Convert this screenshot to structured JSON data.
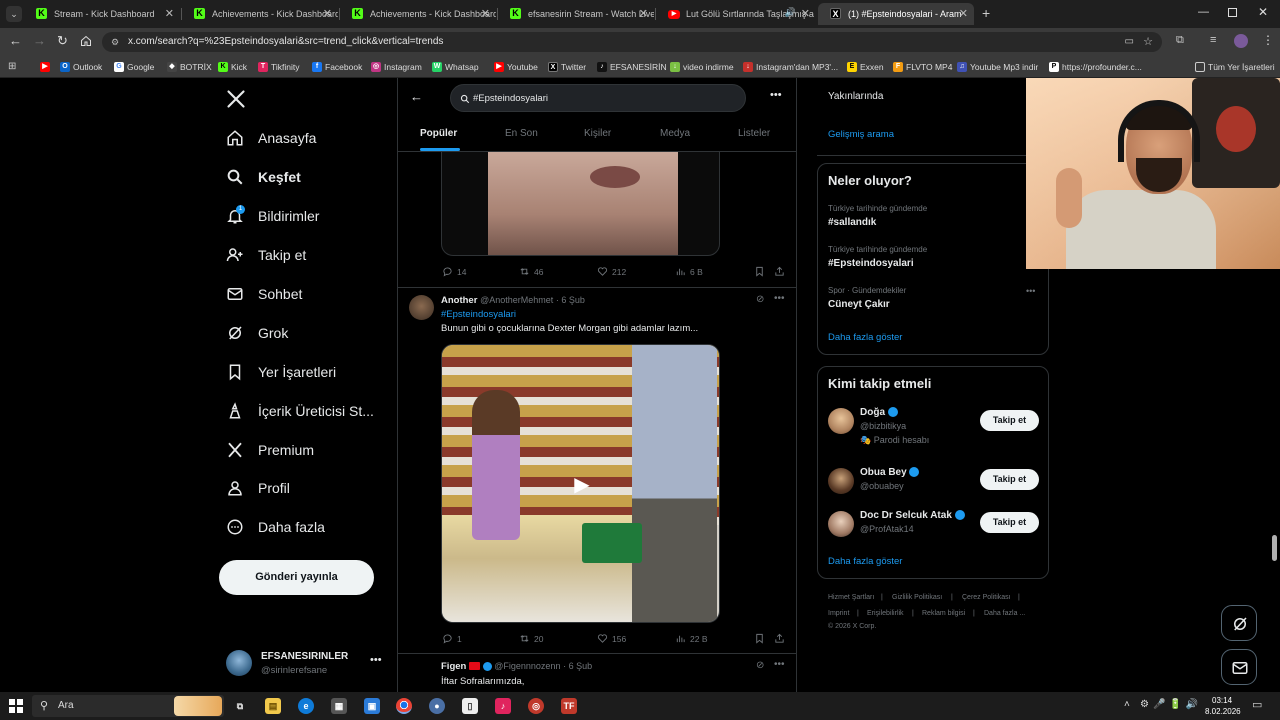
{
  "browser": {
    "tabs": [
      {
        "title": "Stream - Kick Dashboard",
        "icon": "kick-icon"
      },
      {
        "title": "Achievements - Kick Dashboard",
        "icon": "kick-icon"
      },
      {
        "title": "Achievements - Kick Dashboard",
        "icon": "kick-icon"
      },
      {
        "title": "efsanesirin Stream - Watch Live",
        "icon": "kick-icon"
      },
      {
        "title": "Lut Gölü Sırtlarında Taşlaşmış a",
        "icon": "youtube-icon"
      },
      {
        "title": "(1) #Epsteindosyalari - Aram",
        "icon": "x-icon"
      }
    ],
    "url": "x.com/search?q=%23Epsteindosyalari&src=trend_click&vertical=trends",
    "bookmarks": [
      "Outlook",
      "Google",
      "BOTRİX",
      "Kick",
      "Tikfinity",
      "Facebook",
      "Instagram",
      "Whatsap",
      "Youtube",
      "Twitter",
      "EFSANESİRİN",
      "video indirme",
      "Instagram'dan MP3'...",
      "Exxen",
      "FLVTO MP4",
      "Youtube Mp3 indir",
      "https://profounder.c..."
    ],
    "bookmarks_all": "Tüm Yer İşaretleri"
  },
  "nav": {
    "items": [
      {
        "label": "Anasayfa",
        "icon": "home-icon"
      },
      {
        "label": "Keşfet",
        "icon": "search-icon"
      },
      {
        "label": "Bildirimler",
        "icon": "bell-icon",
        "badge": "1"
      },
      {
        "label": "Takip et",
        "icon": "add-user-icon"
      },
      {
        "label": "Sohbet",
        "icon": "mail-icon"
      },
      {
        "label": "Grok",
        "icon": "grok-icon"
      },
      {
        "label": "Yer İşaretleri",
        "icon": "bookmark-icon"
      },
      {
        "label": "İçerik Üreticisi St...",
        "icon": "creator-icon"
      },
      {
        "label": "Premium",
        "icon": "x-icon"
      },
      {
        "label": "Profil",
        "icon": "person-icon"
      },
      {
        "label": "Daha fazla",
        "icon": "more-circle-icon"
      }
    ],
    "post_button": "Gönderi yayınla",
    "account": {
      "name": "EFSANESIRINLER",
      "handle": "@sirinlerefsane"
    }
  },
  "search": {
    "query": "#Epsteindosyalari",
    "tabs": [
      "Popüler",
      "En Son",
      "Kişiler",
      "Medya",
      "Listeler"
    ],
    "active_tab": "Popüler"
  },
  "tweets": [
    {
      "stats": {
        "replies": "14",
        "retweets": "46",
        "likes": "212",
        "views": "6 B"
      }
    },
    {
      "name": "Another",
      "handle": "@AnotherMehmet",
      "date": "· 6 Şub",
      "hashtag": "#Epsteindosyalari",
      "text": "Bunun gibi o çocuklarına Dexter Morgan gibi adamlar lazım...",
      "stats": {
        "replies": "1",
        "retweets": "20",
        "likes": "156",
        "views": "22 B"
      }
    },
    {
      "name": "Figen",
      "handle": "@Figennnozenn",
      "date": "· 6 Şub",
      "text": "İftar Sofralarımızda,"
    }
  ],
  "right": {
    "location_fragment": "Yakınlarında",
    "advanced_search": "Gelişmiş arama",
    "trends_title": "Neler oluyor?",
    "trends": [
      {
        "category": "Türkiye tarihinde gündemde",
        "name": "#sallandık"
      },
      {
        "category": "Türkiye tarihinde gündemde",
        "name": "#Epsteindosyalari"
      },
      {
        "category": "Spor · Gündemdekiler",
        "name": "Cüneyt Çakır"
      }
    ],
    "trends_more": "Daha fazla göster",
    "who_title": "Kimi takip etmeli",
    "who": [
      {
        "name": "Doğa",
        "handle": "@bizbitikya",
        "extra": "Parodi hesabı",
        "button": "Takip et"
      },
      {
        "name": "Obua Bey",
        "handle": "@obuabey",
        "button": "Takip et"
      },
      {
        "name": "Doc Dr Selcuk Atak",
        "handle": "@ProfAtak14",
        "button": "Takip et"
      }
    ],
    "who_more": "Daha fazla göster",
    "footer": [
      "Hizmet Şartları",
      "Gizlilik Politikası",
      "Çerez Politikası",
      "Imprint",
      "Erişilebilirlik",
      "Reklam bilgisi",
      "Daha fazla ...",
      "© 2026 X Corp."
    ]
  },
  "taskbar": {
    "search": "Ara",
    "time": "03:14",
    "date": "8.02.2026"
  },
  "colors": {
    "accent": "#1d9bf0",
    "bg": "#000000",
    "border": "#2f3336",
    "muted": "#71767b"
  }
}
